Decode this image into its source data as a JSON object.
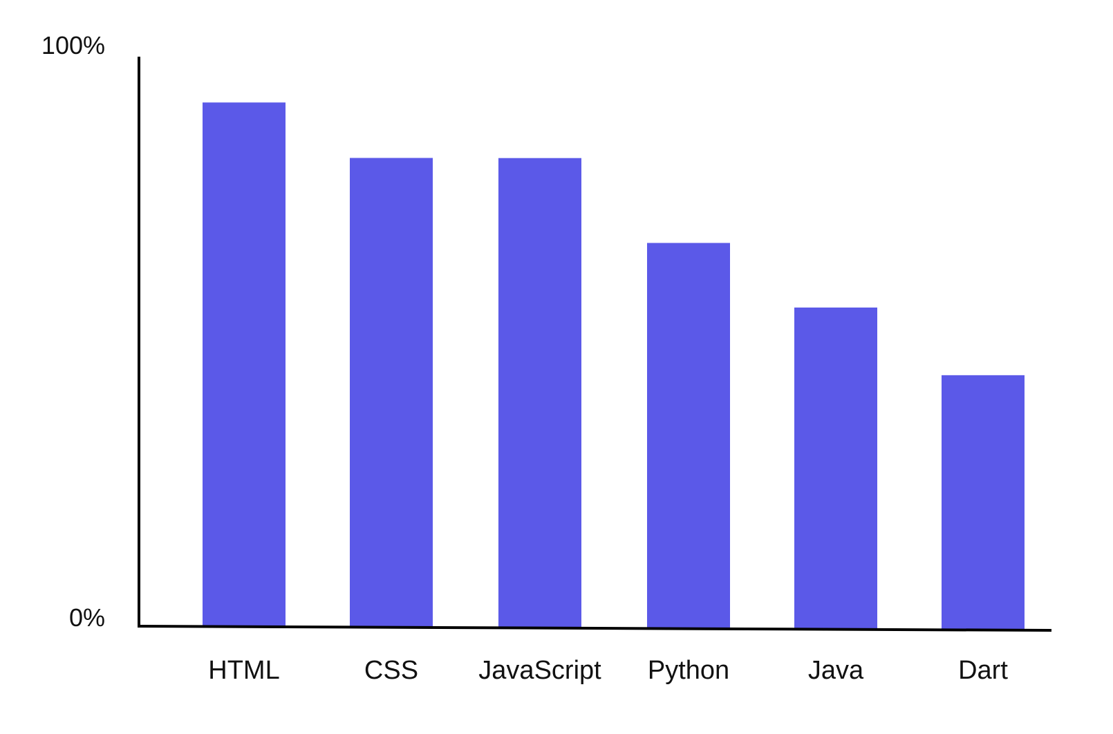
{
  "chart_data": {
    "type": "bar",
    "categories": [
      "HTML",
      "CSS",
      "JavaScript",
      "Python",
      "Java",
      "Dart"
    ],
    "values": [
      90,
      80.5,
      80.5,
      66,
      55,
      43.5
    ],
    "ylim": [
      0,
      100
    ],
    "y_tick_labels": [
      "0%",
      "100%"
    ],
    "title": "",
    "xlabel": "",
    "ylabel": "",
    "grid": false,
    "bar_color": "#5B59E8",
    "axis_color": "#000000"
  }
}
